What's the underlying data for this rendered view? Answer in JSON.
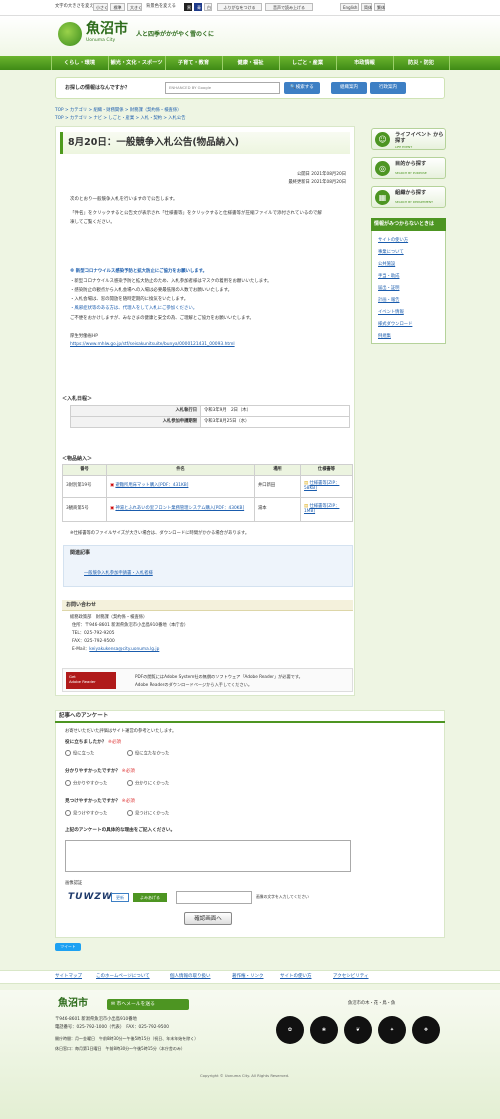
{
  "topbar": {
    "text_size_label": "文字の大きさを変える",
    "text_small": "小さく",
    "text_normal": "標準",
    "text_large": "大きく",
    "bg_label": "背景色を変える",
    "bg_black": "黒",
    "bg_blue": "青",
    "bg_white": "白",
    "furigana": "ふりがなをつける",
    "readaloud": "音声で読み上げる",
    "lang_en": "English",
    "lang_zh_s": "简体",
    "lang_zh_t": "繁体"
  },
  "header": {
    "logo_text": "魚沼市",
    "logo_sub": "Uonuma City",
    "tagline": "人と四季がかがやく雪のくに"
  },
  "nav": {
    "items": [
      "くらし・環境",
      "観光・文化・スポーツ",
      "子育て・教育",
      "健康・福祉",
      "しごと・産業",
      "市政情報",
      "防災・防犯"
    ]
  },
  "search": {
    "question": "お探しの情報はなんですか？",
    "placeholder": "ENHANCED BY Google",
    "search_button": "検索する",
    "org_button": "組織案内",
    "admin_button": "行政案内"
  },
  "breadcrumb": {
    "line1": "TOP > カテゴリ > 組織・財務関係 > 財務課（契約係・検査係）",
    "line2": "TOP > カテゴリ > ナビ > しごと・産業 > 入札・契約 > 入札公告"
  },
  "page": {
    "title": "8月20日：一般競争入札公告(物品納入)",
    "published": "公開日 2021年08月20日",
    "updated": "最終更新日 2021年08月20日",
    "intro": "次のとおり一般競争入札を行いますので公告します。",
    "para1": "「件名」をクリックすると公告文が表示され「仕様書等」をクリックすると仕様書等が圧縮ファイルで添付されているので解",
    "para2": "凍してご覧ください。",
    "notice_title": "※ 新型コロナウイルス感染予防と拡大防止にご協力をお願いします。",
    "notice_1": "・新型コロナウイルス感染予防と拡大防止のため、入札参加者様はマスクの着用をお願いいたします。",
    "notice_2": "・感染防止の観点から入札会場への入場は必要最低限の人数でお願いいたします。",
    "notice_3": "・入札会場は、窓の開放を随時定期的に換気をいたします。",
    "notice_4": "・風邪症状等のある方は、代理人をして入札にご参加ください。",
    "notice_5": "ご不便をおかけしますが、みなさまの健康と安全の為、ご理解とご協力をお願いいたします。",
    "mhlw_label": "厚生労働省HP",
    "mhlw_link": "https://www.mhlw.go.jp/stf/seisakunitsuite/bunya/0000121431_00093.html"
  },
  "schedule": {
    "heading": "＜入札日程＞",
    "rows": [
      {
        "label": "入札執行日",
        "value": "令和3年9月　2日（木）"
      },
      {
        "label": "入札参加申請期限",
        "value": "令和3年8月25日（水）"
      }
    ]
  },
  "goods": {
    "heading": "＜物品納入＞",
    "headers": [
      "番号",
      "件名",
      "場所",
      "仕様書等"
    ],
    "rows": [
      {
        "no": "3財別第19号",
        "name": "避難所用床マット購入[PDF：431KB]",
        "place": "井口新田",
        "spec": "仕様書等[ZIP：58KB]"
      },
      {
        "no": "3観商第5号",
        "name": "神湯とふれあいの里フロント業務管理システム購入[PDF：430KB]",
        "place": "湯本",
        "spec": "仕様書等[ZIP：1MB]"
      }
    ],
    "note": "※仕様書等のファイルサイズが大きい場合は、ダウンロードに時間がかかる場合があります。"
  },
  "related": {
    "heading": "関連記事",
    "link": "一般競争入札参加申請書・入札者様"
  },
  "contact": {
    "heading": "お問い合わせ",
    "dept": "総務政策部　財務課（契約係・検査係）",
    "address": "住所：〒946-8601 新潟県魚沼市小出島910番地（本庁舎）",
    "tel": "TEL：025-792-9205",
    "fax": "FAX：025-792-9500",
    "email_label": "E-Mail：",
    "email": "keiyakukensa@city.uonuma.lg.jp"
  },
  "reader": {
    "logo_line1": "Get",
    "logo_line2": "Adobe Reader",
    "text1": "PDFの閲覧にはAdobe System社の無償のソフトウェア「Adobe Reader」が必要です。",
    "text2": "Adobe Readerのダウンロードページから入手してください。"
  },
  "sidebar": {
    "btn1_title": "ライフイベント から探す",
    "btn1_sub": "LIFE EVENT",
    "btn2_title": "目的から探す",
    "btn2_sub": "SEARCH BY PURPOSE",
    "btn3_title": "組織から探す",
    "btn3_sub": "SEARCH BY DEPARTMENT",
    "useful_heading": "情報がみつからないときは",
    "useful_items": [
      "サイトの使い方",
      "事業について",
      "公共施設",
      "手当・助成",
      "届出・証明",
      "計画・報告",
      "イベント情報",
      "様式ダウンロード",
      "例規集"
    ]
  },
  "survey": {
    "heading": "記事へのアンケート",
    "intro": "お寄せいただいた評価はサイト運営の参考といたします。",
    "q1": "役に立ちましたか？",
    "q2": "分かりやすかったですか？",
    "q3": "見つけやすかったですか？",
    "required": "※必須",
    "q1_a": "役に立った",
    "q1_b": "役に立たなかった",
    "q2_a": "分かりやすかった",
    "q2_b": "分かりにくかった",
    "q3_a": "見つけやすかった",
    "q3_b": "見つけにくかった",
    "free_q": "上記のアンケートの具体的な理由をご記入ください。",
    "captcha_label": "画像認証",
    "captcha_text": "TUWZW",
    "captcha_refresh": "更新",
    "captcha_read": "よみあげる",
    "captcha_hint": "画像の文字を入力してください",
    "confirm": "確認画面へ"
  },
  "share": {
    "tweet": "ツイート"
  },
  "footlinks": [
    "サイトマップ",
    "このホームページについて",
    "個人情報の取り扱い",
    "著作権・リンク",
    "サイトの使い方",
    "アクセシビリティ"
  ],
  "footer": {
    "logo": "魚沼市",
    "mail_button": "市へメールを送る",
    "address": "〒946-8601 新潟県魚沼市小出島910番地",
    "phone": "電話番号：025-792-1000（代表）　FAX：025-792-9500",
    "hours1": "開庁時間：月〜金曜日　午前8時30分〜午後5時15分（祝日、年末年始を除く）",
    "hours2": "休日窓口：毎月第1日曜日　午前8時30分〜午後5時15分（本庁舎のみ）",
    "symbols_title": "魚沼市の木・花・鳥・魚",
    "copyright": "Copyright © Uonuma City. All Rights Reserved."
  },
  "colors": {
    "brand_green": "#4d9522",
    "link_blue": "#1a5cad",
    "button_blue": "#3d7fc4"
  }
}
